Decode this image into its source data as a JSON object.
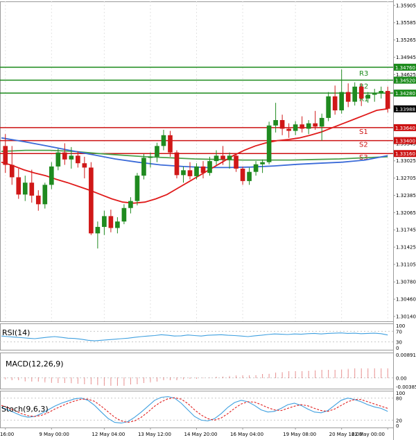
{
  "colors": {
    "frame": "#9a9a9a",
    "grid": "#e2e2e2",
    "candle_up": "#1f8a1f",
    "candle_down": "#d01818",
    "resistance": "#1a8a1a",
    "support": "#cc1111",
    "ma_fast": "#e01a1a",
    "ma_mid": "#3a6ad8",
    "ma_slow": "#4aa04a",
    "rsi": "#3fa0e0",
    "macd": "#d02020",
    "stoch_k": "#3fa0e0",
    "stoch_d": "#e02020",
    "label_bg": "#000000",
    "label_text": "#ffffff"
  },
  "chart_data": [
    {
      "type": "candlestick",
      "panel": "price",
      "ylim": [
        1.3005,
        1.3598
      ],
      "y_ticks": [
        "1.35905",
        "1.35585",
        "1.35265",
        "1.34945",
        "1.34625",
        "1.34305",
        "1.33985",
        "1.33665",
        "1.33345",
        "1.33025",
        "1.32705",
        "1.32385",
        "1.32065",
        "1.31745",
        "1.31425",
        "1.31105",
        "1.30780",
        "1.30460",
        "1.30140"
      ],
      "current_price": "1.33988",
      "levels": [
        {
          "name": "R3",
          "value": 1.3476,
          "label": "1.34760",
          "kind": "resistance"
        },
        {
          "name": "R2",
          "value": 1.3452,
          "label": "1.34520",
          "kind": "resistance"
        },
        {
          "name": "R1",
          "value": 1.3428,
          "label": "1.34280",
          "kind": "resistance"
        },
        {
          "name": "S1",
          "value": 1.3364,
          "label": "1.33640",
          "kind": "support"
        },
        {
          "name": "S2",
          "value": 1.334,
          "label": "1.33400",
          "kind": "support"
        },
        {
          "name": "S3",
          "value": 1.3316,
          "label": "1.33160",
          "kind": "support"
        }
      ],
      "x_labels": [
        "16:00",
        "9 May 00:00",
        "12 May 04:00",
        "13 May 12:00",
        "14 May 20:00",
        "16 May 04:00",
        "19 May 08:00",
        "20 May 16:00",
        "22 May 00:00"
      ],
      "candles": [
        [
          1.333,
          1.3352,
          1.328,
          1.3295
        ],
        [
          1.3295,
          1.333,
          1.3258,
          1.3272
        ],
        [
          1.3272,
          1.3288,
          1.3232,
          1.324
        ],
        [
          1.324,
          1.3275,
          1.3228,
          1.3262
        ],
        [
          1.3262,
          1.3286,
          1.3225,
          1.3238
        ],
        [
          1.3238,
          1.3248,
          1.321,
          1.3222
        ],
        [
          1.3222,
          1.3262,
          1.3214,
          1.3258
        ],
        [
          1.3258,
          1.33,
          1.325,
          1.3292
        ],
        [
          1.3292,
          1.3325,
          1.3285,
          1.3318
        ],
        [
          1.3318,
          1.3335,
          1.3295,
          1.3305
        ],
        [
          1.3305,
          1.3328,
          1.3288,
          1.3312
        ],
        [
          1.3312,
          1.332,
          1.329,
          1.3298
        ],
        [
          1.3298,
          1.331,
          1.327,
          1.329
        ],
        [
          1.329,
          1.33,
          1.3165,
          1.3168
        ],
        [
          1.3168,
          1.319,
          1.314,
          1.318
        ],
        [
          1.318,
          1.321,
          1.3165,
          1.32
        ],
        [
          1.32,
          1.3212,
          1.317,
          1.3178
        ],
        [
          1.3178,
          1.3198,
          1.3168,
          1.319
        ],
        [
          1.319,
          1.3222,
          1.3185,
          1.3215
        ],
        [
          1.3215,
          1.3235,
          1.3205,
          1.3228
        ],
        [
          1.3228,
          1.328,
          1.322,
          1.3275
        ],
        [
          1.3275,
          1.3315,
          1.3268,
          1.3308
        ],
        [
          1.3308,
          1.3318,
          1.329,
          1.331
        ],
        [
          1.331,
          1.3336,
          1.33,
          1.333
        ],
        [
          1.333,
          1.336,
          1.3322,
          1.335
        ],
        [
          1.335,
          1.3358,
          1.331,
          1.3318
        ],
        [
          1.3318,
          1.3322,
          1.327,
          1.3276
        ],
        [
          1.3276,
          1.3292,
          1.3262,
          1.3285
        ],
        [
          1.3285,
          1.33,
          1.3268,
          1.3274
        ],
        [
          1.3274,
          1.3298,
          1.3268,
          1.3292
        ],
        [
          1.3292,
          1.3302,
          1.327,
          1.328
        ],
        [
          1.328,
          1.331,
          1.3275,
          1.3302
        ],
        [
          1.3302,
          1.3322,
          1.3295,
          1.3312
        ],
        [
          1.3312,
          1.333,
          1.3295,
          1.3305
        ],
        [
          1.3305,
          1.3318,
          1.3288,
          1.3312
        ],
        [
          1.3312,
          1.3316,
          1.3282,
          1.3288
        ],
        [
          1.3288,
          1.3292,
          1.3258,
          1.3265
        ],
        [
          1.3265,
          1.329,
          1.3258,
          1.3282
        ],
        [
          1.3282,
          1.3302,
          1.3275,
          1.3296
        ],
        [
          1.3296,
          1.3305,
          1.328,
          1.33
        ],
        [
          1.33,
          1.3375,
          1.3296,
          1.3368
        ],
        [
          1.3368,
          1.341,
          1.3355,
          1.3378
        ],
        [
          1.3378,
          1.3388,
          1.335,
          1.3362
        ],
        [
          1.3362,
          1.3372,
          1.3345,
          1.3358
        ],
        [
          1.3358,
          1.3376,
          1.335,
          1.337
        ],
        [
          1.337,
          1.3385,
          1.3355,
          1.3362
        ],
        [
          1.3362,
          1.3378,
          1.3352,
          1.3372
        ],
        [
          1.3372,
          1.3395,
          1.336,
          1.3366
        ],
        [
          1.3366,
          1.339,
          1.334,
          1.3382
        ],
        [
          1.3382,
          1.343,
          1.3376,
          1.3422
        ],
        [
          1.3422,
          1.3442,
          1.3388,
          1.3396
        ],
        [
          1.3396,
          1.3472,
          1.339,
          1.343
        ],
        [
          1.343,
          1.3446,
          1.3402,
          1.3412
        ],
        [
          1.3412,
          1.3448,
          1.3405,
          1.344
        ],
        [
          1.344,
          1.3446,
          1.3404,
          1.3418
        ],
        [
          1.3418,
          1.343,
          1.341,
          1.3425
        ],
        [
          1.3425,
          1.3436,
          1.3412,
          1.3428
        ],
        [
          1.3428,
          1.344,
          1.3418,
          1.3432
        ],
        [
          1.3432,
          1.344,
          1.3392,
          1.3399
        ]
      ],
      "ma_fast": [
        1.33,
        1.3294,
        1.3286,
        1.328,
        1.3275,
        1.3268,
        1.3262,
        1.3255,
        1.3248,
        1.324,
        1.3232,
        1.3226,
        1.3224,
        1.3226,
        1.3232,
        1.324,
        1.3252,
        1.3264,
        1.3276,
        1.3288,
        1.33,
        1.3312,
        1.3322,
        1.333,
        1.3336,
        1.334,
        1.3342,
        1.3345,
        1.335,
        1.3356,
        1.3364,
        1.3372,
        1.338,
        1.3388,
        1.3396,
        1.3399
      ],
      "ma_mid": [
        1.3345,
        1.3338,
        1.333,
        1.3322,
        1.3314,
        1.3306,
        1.33,
        1.3295,
        1.3292,
        1.329,
        1.329,
        1.3291,
        1.3293,
        1.3296,
        1.3298,
        1.33,
        1.3304,
        1.3312
      ],
      "ma_slow": [
        1.332,
        1.3322,
        1.3322,
        1.332,
        1.3316,
        1.3313,
        1.331,
        1.3308,
        1.3306,
        1.3305,
        1.3304,
        1.3304,
        1.3304,
        1.3305,
        1.3306,
        1.3308,
        1.331
      ]
    },
    {
      "type": "line",
      "panel": "RSI",
      "title": "RSI(14)",
      "ylim": [
        0,
        100
      ],
      "y_ticks": [
        "100",
        "70",
        "30",
        "0"
      ],
      "series": [
        {
          "values": [
            52,
            50,
            48,
            46,
            44,
            42,
            45,
            48,
            50,
            47,
            44,
            43,
            40,
            36,
            34,
            36,
            38,
            40,
            42,
            44,
            47,
            50,
            52,
            54,
            57,
            55,
            52,
            53,
            56,
            54,
            52,
            55,
            56,
            57,
            55,
            54,
            52,
            50,
            53,
            55,
            58,
            60,
            59,
            58,
            60,
            59,
            61,
            62,
            60,
            62,
            63,
            64,
            62,
            63,
            61,
            62,
            63,
            61,
            56
          ]
        }
      ]
    },
    {
      "type": "bar",
      "panel": "MACD",
      "title": "MACD(12,26,9)",
      "ylim": [
        -0.003851,
        0.008918
      ],
      "y_ticks": [
        "0.008918",
        "0.00",
        "-0.003851"
      ],
      "series": [
        {
          "values": [
            -0.0006,
            -0.0008,
            -0.001,
            -0.0012,
            -0.0013,
            -0.0015,
            -0.0016,
            -0.0017,
            -0.0018,
            -0.0019,
            -0.002,
            -0.0021,
            -0.0022,
            -0.0024,
            -0.0026,
            -0.0027,
            -0.0028,
            -0.0028,
            -0.0027,
            -0.0025,
            -0.0022,
            -0.0019,
            -0.0016,
            -0.0013,
            -0.001,
            -0.0009,
            -0.0008,
            -0.0006,
            -0.0005,
            -0.0003,
            -0.0001,
            0.0001,
            0.0003,
            0.0005,
            0.0006,
            0.0007,
            0.0008,
            0.0009,
            0.001,
            0.0012,
            0.0015,
            0.0018,
            0.002,
            0.0022,
            0.0023,
            0.0024,
            0.0025,
            0.0026,
            0.0027,
            0.0028,
            0.0029,
            0.003,
            0.0031,
            0.0032,
            0.0032,
            0.0033,
            0.0033,
            0.0034,
            0.0034
          ]
        }
      ]
    },
    {
      "type": "line",
      "panel": "Stochastic",
      "title": "Stoch(9,6,3)",
      "ylim": [
        0,
        100
      ],
      "y_ticks": [
        "100",
        "80",
        "20",
        "0"
      ],
      "series": [
        {
          "values": [
            55,
            48,
            40,
            32,
            28,
            30,
            38,
            48,
            58,
            66,
            72,
            78,
            80,
            74,
            60,
            42,
            25,
            14,
            12,
            16,
            28,
            42,
            58,
            74,
            82,
            84,
            80,
            66,
            48,
            30,
            20,
            18,
            24,
            38,
            55,
            68,
            74,
            70,
            60,
            48,
            42,
            44,
            52,
            62,
            66,
            60,
            50,
            42,
            40,
            46,
            60,
            74,
            80,
            76,
            70,
            62,
            56,
            52,
            44
          ]
        },
        {
          "values": [
            60,
            54,
            46,
            38,
            32,
            30,
            33,
            40,
            50,
            58,
            66,
            72,
            77,
            77,
            71,
            58,
            43,
            28,
            18,
            14,
            18,
            28,
            42,
            58,
            70,
            78,
            81,
            77,
            65,
            48,
            34,
            24,
            20,
            26,
            38,
            52,
            64,
            70,
            69,
            62,
            54,
            48,
            46,
            52,
            58,
            62,
            59,
            52,
            46,
            44,
            50,
            60,
            70,
            76,
            76,
            70,
            64,
            58,
            52
          ]
        }
      ]
    }
  ]
}
